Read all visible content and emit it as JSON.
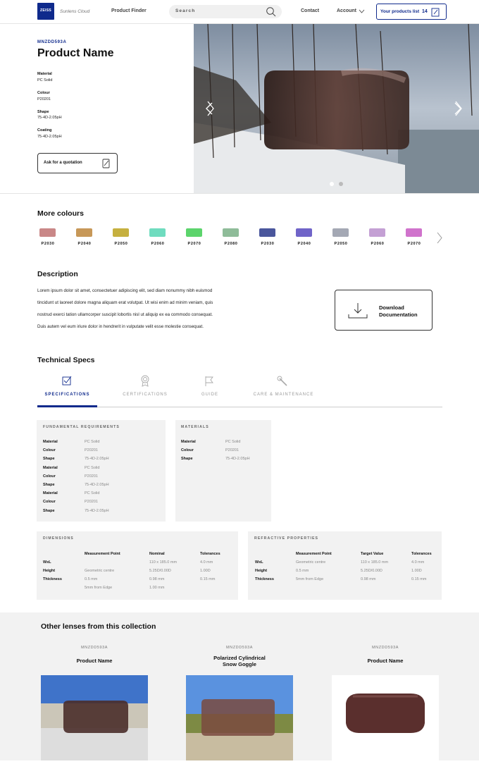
{
  "header": {
    "brand": "ZEISS",
    "subtitle": "Sunlens Cloud",
    "nav_product_finder": "Product Finder",
    "search_placeholder": "Search",
    "nav_contact": "Contact",
    "nav_account": "Account",
    "products_list_label": "Your products list",
    "products_list_count": "14"
  },
  "product": {
    "sku": "MNZDD593A",
    "name": "Product Name",
    "attributes": [
      {
        "label": "Material",
        "value": "PC Solid"
      },
      {
        "label": "Colour",
        "value": "P20201"
      },
      {
        "label": "Shape",
        "value": "75-4D-2.05pH"
      },
      {
        "label": "Coating",
        "value": "75-4D-2.05pH"
      }
    ],
    "quote_label": "Ask for a quotation"
  },
  "more_colours": {
    "title": "More colours",
    "swatches": [
      {
        "code": "P2030",
        "color": "#c98787"
      },
      {
        "code": "P2040",
        "color": "#c79858"
      },
      {
        "code": "P2050",
        "color": "#c6b03f"
      },
      {
        "code": "P2060",
        "color": "#6fdcbf"
      },
      {
        "code": "P2070",
        "color": "#5cd46c"
      },
      {
        "code": "P2080",
        "color": "#8fbc99"
      },
      {
        "code": "P2030",
        "color": "#4a569c"
      },
      {
        "code": "P2040",
        "color": "#7064c8"
      },
      {
        "code": "P2050",
        "color": "#a4a8b4"
      },
      {
        "code": "P2060",
        "color": "#c4a0d4"
      },
      {
        "code": "P2070",
        "color": "#d073cc"
      }
    ]
  },
  "description": {
    "title": "Description",
    "lines": [
      "Lorem ipsum dolor sit amet, consectetuer adipiscing elit, sed diam nonummy nibh euismod",
      "tincidunt ut laoreet dolore magna aliquam erat volutpat. Ut wisi enim ad minim veniam, quis",
      "nostrud exerci tation ullamcorper suscipit lobortis nisl ut aliquip ex ea commodo consequat.",
      "Duis autem vel eum iriure dolor in hendrerit in vulputate velit esse molestie consequat."
    ],
    "download_label_1": "Download",
    "download_label_2": "Documentation"
  },
  "tech": {
    "title": "Technical Specs",
    "tabs": [
      "SPECIFICATIONS",
      "CERTIFICATIONS",
      "GUIDE",
      "CARE & MAINTENANCE"
    ],
    "fundamental": {
      "heading": "FUNDAMENTAL REQUIREMENTS",
      "rows": [
        [
          "Material",
          "PC Solid"
        ],
        [
          "Colour",
          "P20201"
        ],
        [
          "Shape",
          "75-4D-2.05pH"
        ],
        [
          "Material",
          "PC Solid"
        ],
        [
          "Colour",
          "P20201"
        ],
        [
          "Shape",
          "75-4D-2.05pH"
        ],
        [
          "Material",
          "PC Solid"
        ],
        [
          "Colour",
          "P20201"
        ],
        [
          "Shape",
          "75-4D-2.05pH"
        ]
      ]
    },
    "materials": {
      "heading": "MATERIALS",
      "rows": [
        [
          "Material",
          "PC Solid"
        ],
        [
          "Colour",
          "P20201"
        ],
        [
          "Shape",
          "75-4D-2.05pH"
        ]
      ]
    },
    "dimensions": {
      "heading": "DIMENSIONS",
      "cols": [
        "Measurement Point",
        "Nominal",
        "Tolerances"
      ],
      "rows": [
        [
          "WxL",
          "",
          "110 x 185.0 mm",
          "4.0 mm"
        ],
        [
          "Height",
          "Geometric centre",
          "5.25D/0.00D",
          "1.00D"
        ],
        [
          "Thickness",
          "0.5 mm",
          "0.98 mm",
          "0.15 mm"
        ],
        [
          "",
          "5mm from Edge",
          "1.00 mm",
          ""
        ]
      ]
    },
    "refractive": {
      "heading": "REFRACTIVE PROPERTIES",
      "cols": [
        "Measurement Point",
        "Target Value",
        "Tolerances"
      ],
      "rows": [
        [
          "WxL",
          "Geometric centre",
          "110 x 185.0 mm",
          "4.0 mm"
        ],
        [
          "Height",
          "0.5 mm",
          "5.25D/0.00D",
          "1.00D"
        ],
        [
          "Thickness",
          "5mm from Edge",
          "0.98 mm",
          "0.15 mm"
        ]
      ]
    }
  },
  "collection": {
    "title": "Other lenses from this collection",
    "items": [
      {
        "sku": "MNZDD593A",
        "name1": "Product Name",
        "name2": ""
      },
      {
        "sku": "MNZDD593A",
        "name1": "Polarized Cylindrical",
        "name2": "Snow Goggle"
      },
      {
        "sku": "MNZDD593A",
        "name1": "Product Name",
        "name2": ""
      }
    ]
  }
}
